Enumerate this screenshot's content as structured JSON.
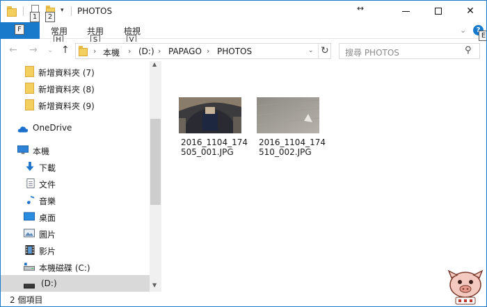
{
  "window": {
    "title": "PHOTOS",
    "resize_glyph": "↔",
    "minimize_icon": "minimize-icon",
    "maximize_icon": "maximize-icon",
    "close_glyph": "✕"
  },
  "quick_access": {
    "keytips": [
      "1",
      "2"
    ],
    "dropdown_glyph": "▾"
  },
  "ribbon": {
    "file_tab": "檔",
    "file_keytip": "F",
    "tabs": [
      {
        "label": "常用",
        "keytip": "H"
      },
      {
        "label": "共用",
        "keytip": "S"
      },
      {
        "label": "檢視",
        "keytip": "V"
      }
    ],
    "collapse_glyph": "⌄",
    "help_glyph": "?",
    "help_keytip": "E"
  },
  "address": {
    "back_glyph": "←",
    "forward_glyph": "→",
    "recent_glyph": "⌄",
    "up_glyph": "↑",
    "crumb_sep": "›",
    "crumbs": [
      "本機",
      "(D:)",
      "PAPAGO",
      "PHOTOS"
    ],
    "dropdown_glyph": "⌄",
    "refresh_glyph": "↻",
    "search_placeholder": "搜尋 PHOTOS",
    "search_glyph": "⚲"
  },
  "nav_pane": {
    "items": [
      {
        "label": "新增資料夾 (7)",
        "icon": "folder-icon"
      },
      {
        "label": "新增資料夾 (8)",
        "icon": "folder-icon"
      },
      {
        "label": "新增資料夾 (9)",
        "icon": "folder-icon"
      },
      {
        "label": "OneDrive",
        "icon": "cloud-icon"
      },
      {
        "label": "本機",
        "icon": "computer-icon"
      },
      {
        "label": "下載",
        "icon": "download-icon"
      },
      {
        "label": "文件",
        "icon": "document-icon"
      },
      {
        "label": "音樂",
        "icon": "music-icon"
      },
      {
        "label": "桌面",
        "icon": "desktop-icon"
      },
      {
        "label": "圖片",
        "icon": "pictures-icon"
      },
      {
        "label": "影片",
        "icon": "video-icon"
      },
      {
        "label": "本機磁碟 (C:)",
        "icon": "drive-icon"
      },
      {
        "label": "(D:)",
        "icon": "drive-icon"
      }
    ],
    "selected": "(D:)",
    "scroll_up_glyph": "▲",
    "scroll_down_glyph": "▼"
  },
  "files": [
    {
      "name": "2016_1104_174505_001.JPG",
      "line1": "2016_1104_174",
      "line2": "505_001.JPG"
    },
    {
      "name": "2016_1104_174510_002.JPG",
      "line1": "2016_1104_174",
      "line2": "510_002.JPG"
    }
  ],
  "status": {
    "item_count": "2 個項目"
  },
  "colors": {
    "accent": "#1979ca",
    "folder": "#f3cf60",
    "selection": "#d9d9d9"
  }
}
